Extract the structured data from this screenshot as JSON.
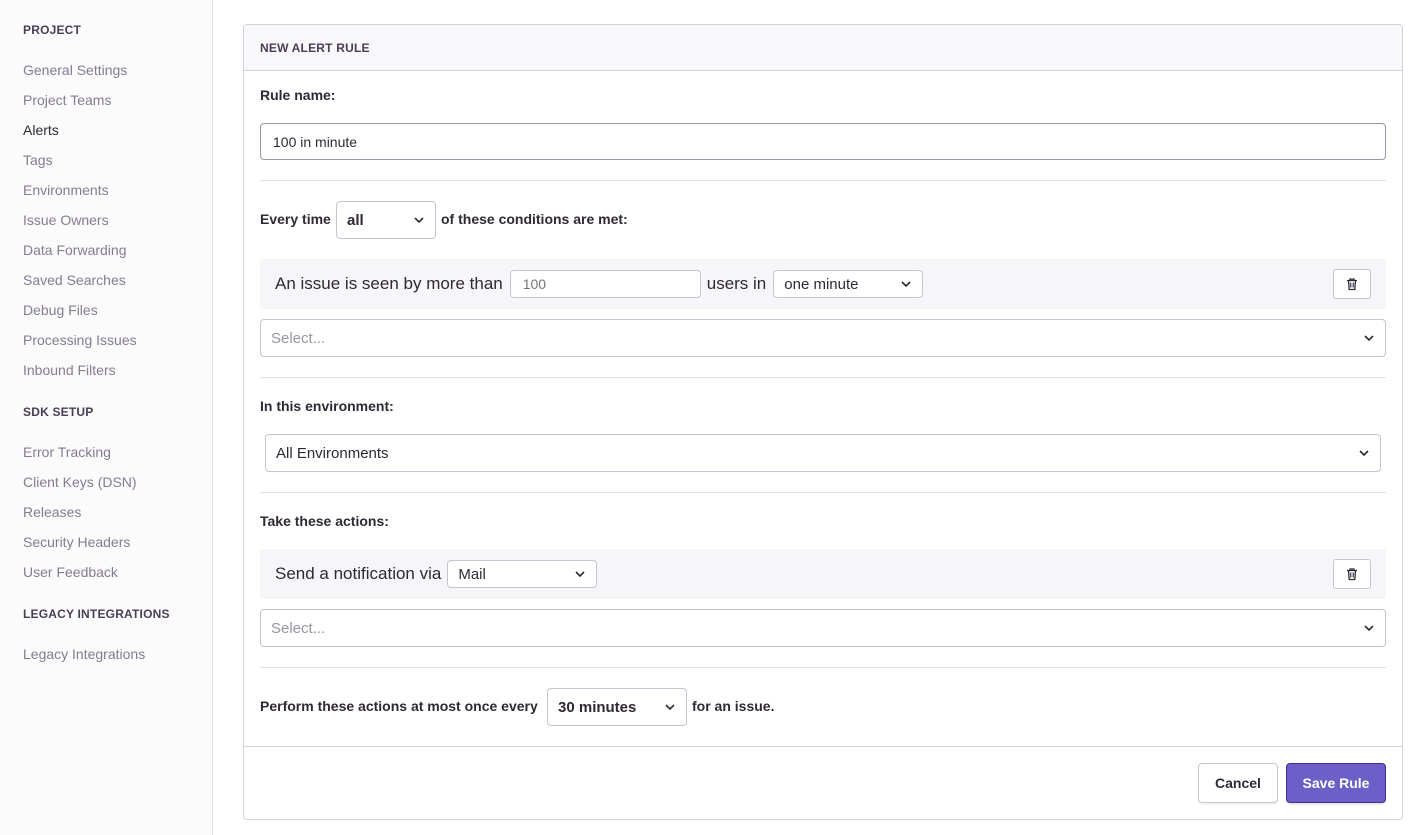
{
  "sidebar": {
    "project_heading": "PROJECT",
    "project_items": [
      {
        "label": "General Settings"
      },
      {
        "label": "Project Teams"
      },
      {
        "label": "Alerts",
        "active": true
      },
      {
        "label": "Tags"
      },
      {
        "label": "Environments"
      },
      {
        "label": "Issue Owners"
      },
      {
        "label": "Data Forwarding"
      },
      {
        "label": "Saved Searches"
      },
      {
        "label": "Debug Files"
      },
      {
        "label": "Processing Issues"
      },
      {
        "label": "Inbound Filters"
      }
    ],
    "sdk_heading": "SDK SETUP",
    "sdk_items": [
      {
        "label": "Error Tracking"
      },
      {
        "label": "Client Keys (DSN)"
      },
      {
        "label": "Releases"
      },
      {
        "label": "Security Headers"
      },
      {
        "label": "User Feedback"
      }
    ],
    "legacy_heading": "LEGACY INTEGRATIONS",
    "legacy_items": [
      {
        "label": "Legacy Integrations"
      }
    ]
  },
  "panel": {
    "title": "NEW ALERT RULE",
    "rule_name_label": "Rule name:",
    "rule_name_value": "100 in minute",
    "every_time_label": "Every time",
    "match_select": "all",
    "conditions_suffix": "of these conditions are met:",
    "condition": {
      "prefix": "An issue is seen by more than",
      "value_placeholder": "100",
      "middle": "users in",
      "interval": "one minute"
    },
    "condition_select_placeholder": "Select...",
    "environment_label": "In this environment:",
    "environment_value": "All Environments",
    "actions_label": "Take these actions:",
    "action": {
      "prefix": "Send a notification via",
      "service": "Mail"
    },
    "action_select_placeholder": "Select...",
    "frequency_prefix": "Perform these actions at most once every",
    "frequency_value": "30 minutes",
    "frequency_suffix": "for an issue.",
    "cancel_label": "Cancel",
    "save_label": "Save Rule"
  },
  "colors": {
    "accent": "#6c5fc7",
    "sidebar_bg": "#fbfbfc",
    "border": "#d6d0dc"
  },
  "icons": {
    "delete": "trash-icon",
    "dropdown": "chevron-down-icon"
  }
}
